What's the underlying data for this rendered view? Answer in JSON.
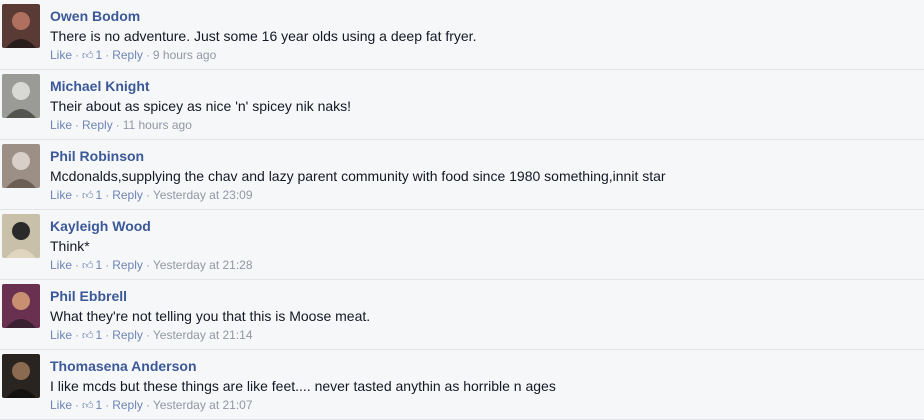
{
  "comments": [
    {
      "author": "Owen Bodom",
      "text": "There is no adventure. Just some 16 year olds using a deep fat fryer.",
      "like": "Like",
      "likes": "1",
      "reply": "Reply",
      "time": "9 hours ago",
      "avatar_colors": [
        "#5a3a35",
        "#b07060",
        "#2a1e1c"
      ]
    },
    {
      "author": "Michael Knight",
      "text": "Their about as spicey as nice 'n' spicey nik naks!",
      "like": "Like",
      "likes": "",
      "reply": "Reply",
      "time": "11 hours ago",
      "avatar_colors": [
        "#9a9a96",
        "#d8d8d4",
        "#555550"
      ]
    },
    {
      "author": "Phil Robinson",
      "text": "Mcdonalds,supplying the chav and lazy parent community with food since 1980 something,innit star",
      "like": "Like",
      "likes": "1",
      "reply": "Reply",
      "time": "Yesterday at 23:09",
      "avatar_colors": [
        "#9c8f86",
        "#d8d0c8",
        "#6a5e55"
      ]
    },
    {
      "author": "Kayleigh Wood",
      "text": "Think*",
      "like": "Like",
      "likes": "1",
      "reply": "Reply",
      "time": "Yesterday at 21:28",
      "avatar_colors": [
        "#c8c0a8",
        "#2a2a2a",
        "#e0d6c0"
      ]
    },
    {
      "author": "Phil Ebbrell",
      "text": "What they're not telling you that this is Moose meat.",
      "like": "Like",
      "likes": "1",
      "reply": "Reply",
      "time": "Yesterday at 21:14",
      "avatar_colors": [
        "#6a3050",
        "#c89070",
        "#3a2030"
      ]
    },
    {
      "author": "Thomasena Anderson",
      "text": "I like mcds but these things are like feet.... never tasted anythin as horrible n ages",
      "like": "Like",
      "likes": "1",
      "reply": "Reply",
      "time": "Yesterday at 21:07",
      "avatar_colors": [
        "#2a2420",
        "#8a6a50",
        "#141210"
      ]
    }
  ]
}
